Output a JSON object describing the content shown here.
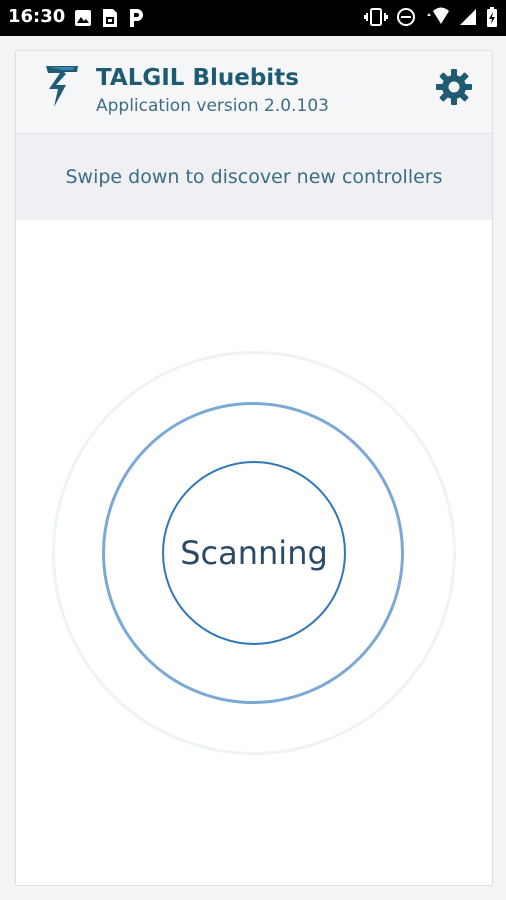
{
  "status_bar": {
    "time": "16:30",
    "left_icons": [
      "image-icon",
      "sim-card-icon",
      "parking-icon"
    ],
    "right_icons": [
      "vibrate-icon",
      "do-not-disturb-icon",
      "wifi-icon",
      "signal-icon",
      "battery-icon"
    ]
  },
  "header": {
    "title": "TALGIL Bluebits",
    "version": "Application version 2.0.103",
    "settings_icon": "gear-icon"
  },
  "hint": {
    "text": "Swipe down to discover new controllers"
  },
  "scanner": {
    "label": "Scanning"
  },
  "colors": {
    "brand_text": "#1f5b73",
    "ring_outer": "#eef3f8",
    "ring_middle": "#7aa9d6",
    "ring_inner": "#2f78b8"
  }
}
